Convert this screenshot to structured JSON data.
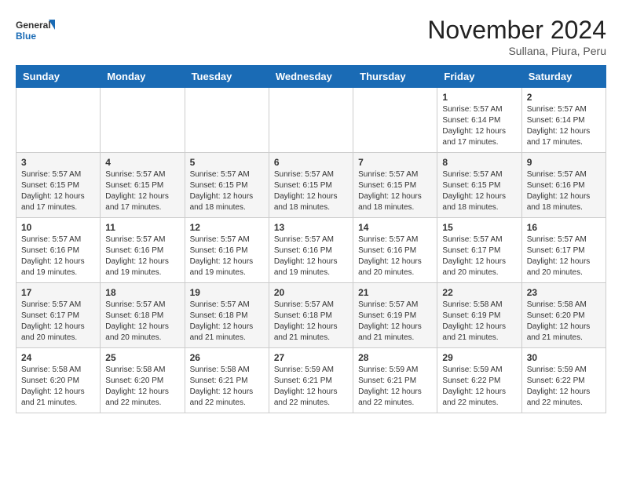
{
  "logo": {
    "text_general": "General",
    "text_blue": "Blue"
  },
  "header": {
    "month": "November 2024",
    "location": "Sullana, Piura, Peru"
  },
  "days_of_week": [
    "Sunday",
    "Monday",
    "Tuesday",
    "Wednesday",
    "Thursday",
    "Friday",
    "Saturday"
  ],
  "weeks": [
    [
      {
        "day": "",
        "info": ""
      },
      {
        "day": "",
        "info": ""
      },
      {
        "day": "",
        "info": ""
      },
      {
        "day": "",
        "info": ""
      },
      {
        "day": "",
        "info": ""
      },
      {
        "day": "1",
        "info": "Sunrise: 5:57 AM\nSunset: 6:14 PM\nDaylight: 12 hours and 17 minutes."
      },
      {
        "day": "2",
        "info": "Sunrise: 5:57 AM\nSunset: 6:14 PM\nDaylight: 12 hours and 17 minutes."
      }
    ],
    [
      {
        "day": "3",
        "info": "Sunrise: 5:57 AM\nSunset: 6:15 PM\nDaylight: 12 hours and 17 minutes."
      },
      {
        "day": "4",
        "info": "Sunrise: 5:57 AM\nSunset: 6:15 PM\nDaylight: 12 hours and 17 minutes."
      },
      {
        "day": "5",
        "info": "Sunrise: 5:57 AM\nSunset: 6:15 PM\nDaylight: 12 hours and 18 minutes."
      },
      {
        "day": "6",
        "info": "Sunrise: 5:57 AM\nSunset: 6:15 PM\nDaylight: 12 hours and 18 minutes."
      },
      {
        "day": "7",
        "info": "Sunrise: 5:57 AM\nSunset: 6:15 PM\nDaylight: 12 hours and 18 minutes."
      },
      {
        "day": "8",
        "info": "Sunrise: 5:57 AM\nSunset: 6:15 PM\nDaylight: 12 hours and 18 minutes."
      },
      {
        "day": "9",
        "info": "Sunrise: 5:57 AM\nSunset: 6:16 PM\nDaylight: 12 hours and 18 minutes."
      }
    ],
    [
      {
        "day": "10",
        "info": "Sunrise: 5:57 AM\nSunset: 6:16 PM\nDaylight: 12 hours and 19 minutes."
      },
      {
        "day": "11",
        "info": "Sunrise: 5:57 AM\nSunset: 6:16 PM\nDaylight: 12 hours and 19 minutes."
      },
      {
        "day": "12",
        "info": "Sunrise: 5:57 AM\nSunset: 6:16 PM\nDaylight: 12 hours and 19 minutes."
      },
      {
        "day": "13",
        "info": "Sunrise: 5:57 AM\nSunset: 6:16 PM\nDaylight: 12 hours and 19 minutes."
      },
      {
        "day": "14",
        "info": "Sunrise: 5:57 AM\nSunset: 6:16 PM\nDaylight: 12 hours and 20 minutes."
      },
      {
        "day": "15",
        "info": "Sunrise: 5:57 AM\nSunset: 6:17 PM\nDaylight: 12 hours and 20 minutes."
      },
      {
        "day": "16",
        "info": "Sunrise: 5:57 AM\nSunset: 6:17 PM\nDaylight: 12 hours and 20 minutes."
      }
    ],
    [
      {
        "day": "17",
        "info": "Sunrise: 5:57 AM\nSunset: 6:17 PM\nDaylight: 12 hours and 20 minutes."
      },
      {
        "day": "18",
        "info": "Sunrise: 5:57 AM\nSunset: 6:18 PM\nDaylight: 12 hours and 20 minutes."
      },
      {
        "day": "19",
        "info": "Sunrise: 5:57 AM\nSunset: 6:18 PM\nDaylight: 12 hours and 21 minutes."
      },
      {
        "day": "20",
        "info": "Sunrise: 5:57 AM\nSunset: 6:18 PM\nDaylight: 12 hours and 21 minutes."
      },
      {
        "day": "21",
        "info": "Sunrise: 5:57 AM\nSunset: 6:19 PM\nDaylight: 12 hours and 21 minutes."
      },
      {
        "day": "22",
        "info": "Sunrise: 5:58 AM\nSunset: 6:19 PM\nDaylight: 12 hours and 21 minutes."
      },
      {
        "day": "23",
        "info": "Sunrise: 5:58 AM\nSunset: 6:20 PM\nDaylight: 12 hours and 21 minutes."
      }
    ],
    [
      {
        "day": "24",
        "info": "Sunrise: 5:58 AM\nSunset: 6:20 PM\nDaylight: 12 hours and 21 minutes."
      },
      {
        "day": "25",
        "info": "Sunrise: 5:58 AM\nSunset: 6:20 PM\nDaylight: 12 hours and 22 minutes."
      },
      {
        "day": "26",
        "info": "Sunrise: 5:58 AM\nSunset: 6:21 PM\nDaylight: 12 hours and 22 minutes."
      },
      {
        "day": "27",
        "info": "Sunrise: 5:59 AM\nSunset: 6:21 PM\nDaylight: 12 hours and 22 minutes."
      },
      {
        "day": "28",
        "info": "Sunrise: 5:59 AM\nSunset: 6:21 PM\nDaylight: 12 hours and 22 minutes."
      },
      {
        "day": "29",
        "info": "Sunrise: 5:59 AM\nSunset: 6:22 PM\nDaylight: 12 hours and 22 minutes."
      },
      {
        "day": "30",
        "info": "Sunrise: 5:59 AM\nSunset: 6:22 PM\nDaylight: 12 hours and 22 minutes."
      }
    ]
  ]
}
